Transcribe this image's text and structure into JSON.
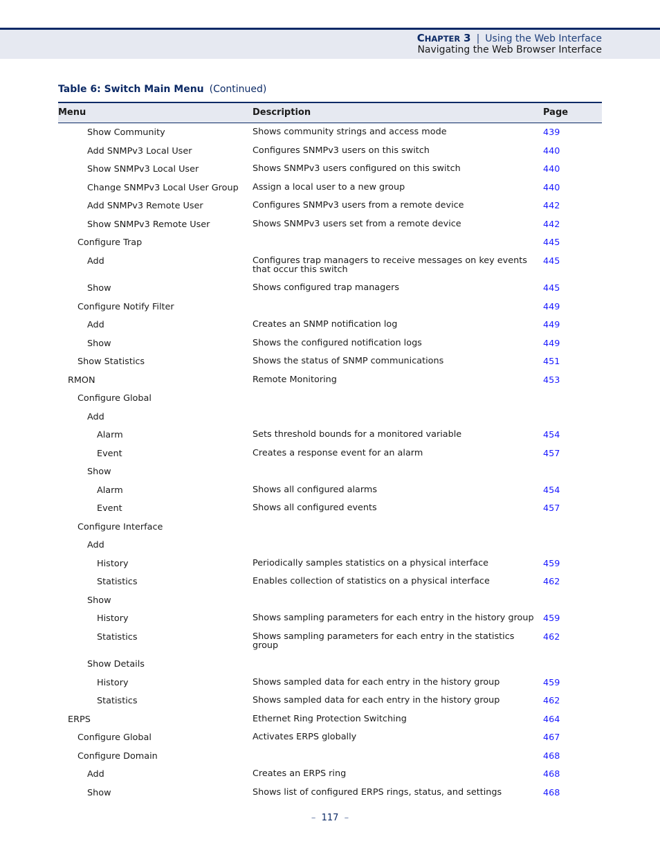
{
  "header": {
    "chapter_label": "Chapter",
    "chapter_number": "3",
    "separator": "|",
    "chapter_title": "Using the Web Interface",
    "section_title": "Navigating the Web Browser Interface"
  },
  "table": {
    "caption": "Table 6: Switch Main Menu",
    "caption_suffix": "(Continued)",
    "columns": [
      "Menu",
      "Description",
      "Page"
    ],
    "rows": [
      {
        "level": 3,
        "menu": "Show Community",
        "description": "Shows community strings and access mode",
        "page": "439"
      },
      {
        "level": 3,
        "menu": "Add SNMPv3 Local User",
        "description": "Configures SNMPv3 users on this switch",
        "page": "440"
      },
      {
        "level": 3,
        "menu": "Show SNMPv3 Local User",
        "description": "Shows SNMPv3 users configured on this switch",
        "page": "440"
      },
      {
        "level": 3,
        "menu": "Change SNMPv3 Local User Group",
        "description": "Assign a local user to a new group",
        "page": "440"
      },
      {
        "level": 3,
        "menu": "Add SNMPv3 Remote User",
        "description": "Configures SNMPv3 users from a remote device",
        "page": "442"
      },
      {
        "level": 3,
        "menu": "Show SNMPv3 Remote User",
        "description": "Shows SNMPv3 users set from a remote device",
        "page": "442"
      },
      {
        "level": 2,
        "menu": "Configure Trap",
        "description": "",
        "page": "445"
      },
      {
        "level": 3,
        "menu": "Add",
        "description": "Configures trap managers to receive messages on key events that occur this switch",
        "page": "445"
      },
      {
        "level": 3,
        "menu": "Show",
        "description": "Shows configured trap managers",
        "page": "445"
      },
      {
        "level": 2,
        "menu": "Configure Notify Filter",
        "description": "",
        "page": "449"
      },
      {
        "level": 3,
        "menu": "Add",
        "description": "Creates an SNMP notification log",
        "page": "449"
      },
      {
        "level": 3,
        "menu": "Show",
        "description": "Shows the configured notification logs",
        "page": "449"
      },
      {
        "level": 2,
        "menu": "Show Statistics",
        "description": "Shows the status of SNMP communications",
        "page": "451"
      },
      {
        "level": 1,
        "menu": "RMON",
        "description": "Remote Monitoring",
        "page": "453"
      },
      {
        "level": 2,
        "menu": "Configure Global",
        "description": "",
        "page": ""
      },
      {
        "level": 3,
        "menu": "Add",
        "description": "",
        "page": ""
      },
      {
        "level": 4,
        "menu": "Alarm",
        "description": "Sets threshold bounds for a monitored variable",
        "page": "454"
      },
      {
        "level": 4,
        "menu": "Event",
        "description": "Creates a response event for an alarm",
        "page": "457"
      },
      {
        "level": 3,
        "menu": "Show",
        "description": "",
        "page": ""
      },
      {
        "level": 4,
        "menu": "Alarm",
        "description": "Shows all configured alarms",
        "page": "454"
      },
      {
        "level": 4,
        "menu": "Event",
        "description": "Shows all configured events",
        "page": "457"
      },
      {
        "level": 2,
        "menu": "Configure Interface",
        "description": "",
        "page": ""
      },
      {
        "level": 3,
        "menu": "Add",
        "description": "",
        "page": ""
      },
      {
        "level": 4,
        "menu": "History",
        "description": "Periodically samples statistics on a physical interface",
        "page": "459"
      },
      {
        "level": 4,
        "menu": "Statistics",
        "description": "Enables collection of statistics on a physical interface",
        "page": "462"
      },
      {
        "level": 3,
        "menu": "Show",
        "description": "",
        "page": ""
      },
      {
        "level": 4,
        "menu": "History",
        "description": "Shows sampling parameters for each entry in the history group",
        "page": "459"
      },
      {
        "level": 4,
        "menu": "Statistics",
        "description": "Shows sampling parameters for each entry in the statistics group",
        "page": "462"
      },
      {
        "level": 3,
        "menu": "Show Details",
        "description": "",
        "page": ""
      },
      {
        "level": 4,
        "menu": "History",
        "description": "Shows sampled data for each entry in the history group",
        "page": "459"
      },
      {
        "level": 4,
        "menu": "Statistics",
        "description": "Shows sampled data for each entry in the history group",
        "page": "462"
      },
      {
        "level": 1,
        "menu": "ERPS",
        "description": "Ethernet Ring Protection Switching",
        "page": "464"
      },
      {
        "level": 2,
        "menu": "Configure Global",
        "description": "Activates ERPS globally",
        "page": "467"
      },
      {
        "level": 2,
        "menu": "Configure Domain",
        "description": "",
        "page": "468"
      },
      {
        "level": 3,
        "menu": "Add",
        "description": "Creates an ERPS ring",
        "page": "468"
      },
      {
        "level": 3,
        "menu": "Show",
        "description": "Shows list of configured ERPS rings, status, and settings",
        "page": "468"
      }
    ]
  },
  "footer": {
    "dash": "–",
    "page_number": "117"
  }
}
